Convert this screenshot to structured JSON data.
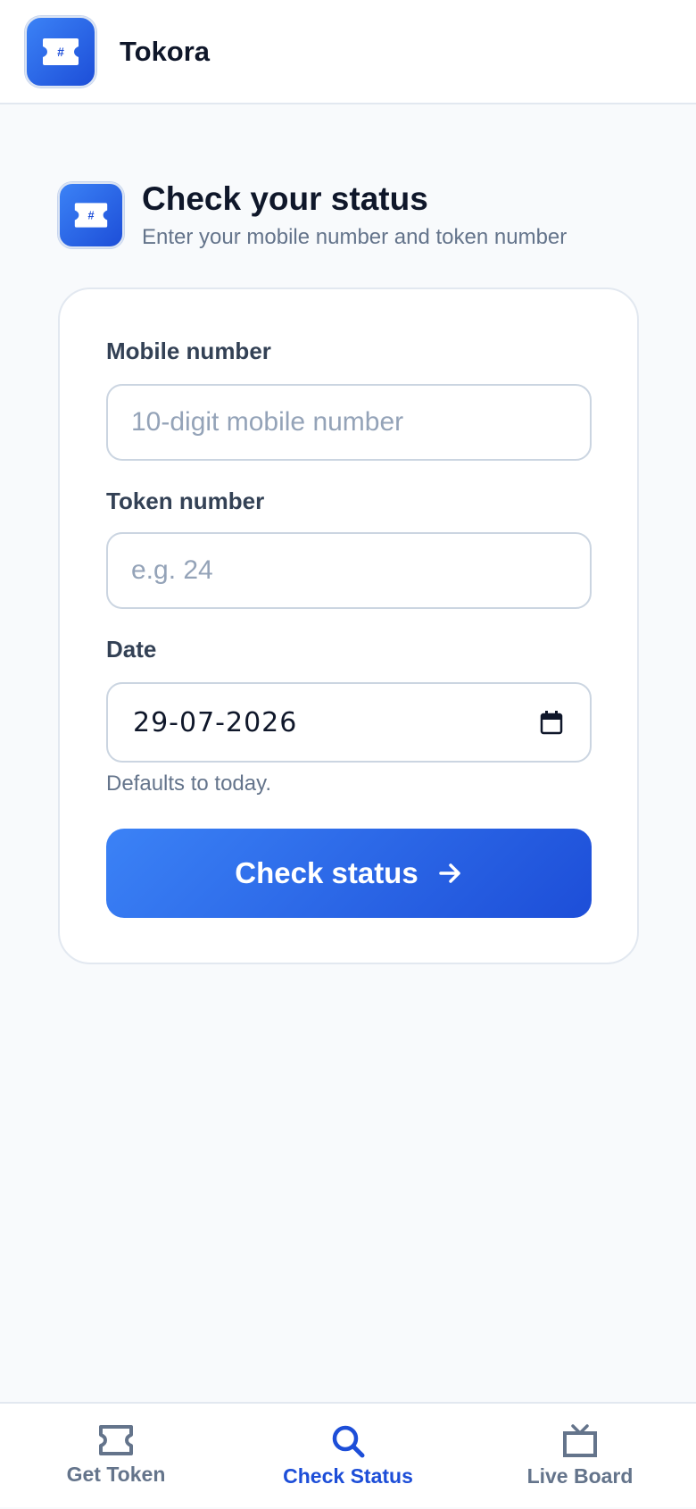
{
  "app": {
    "name": "Tokora",
    "logo_glyph": "#"
  },
  "page": {
    "title": "Check your status",
    "subtitle": "Enter your mobile number and token number",
    "icon_glyph": "#"
  },
  "form": {
    "mobile": {
      "label": "Mobile number",
      "placeholder": "10-digit mobile number",
      "value": ""
    },
    "token": {
      "label": "Token number",
      "placeholder": "e.g. 24",
      "value": ""
    },
    "date": {
      "label": "Date",
      "value": "29-07-2026",
      "hint": "Defaults to today."
    },
    "submit_label": "Check status"
  },
  "nav": {
    "items": [
      {
        "label": "Get Token",
        "icon": "ticket-icon",
        "active": false
      },
      {
        "label": "Check Status",
        "icon": "search-icon",
        "active": true
      },
      {
        "label": "Live Board",
        "icon": "tv-icon",
        "active": false
      }
    ]
  },
  "colors": {
    "accent": "#2563eb",
    "accent_dark": "#1d4ed8",
    "text_primary": "#0f172a",
    "text_muted": "#64748b",
    "background": "#f8fafc"
  }
}
